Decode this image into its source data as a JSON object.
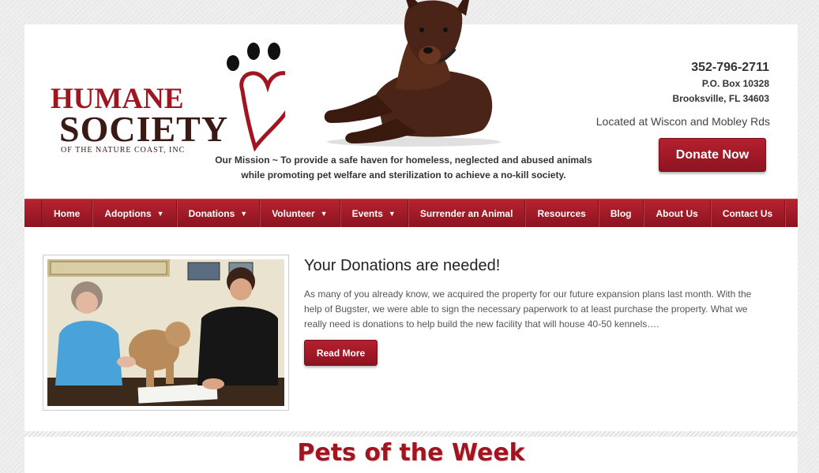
{
  "logo": {
    "word1": "HUMANE",
    "word2": "SOCIETY",
    "subtitle": "OF THE NATURE COAST, INC"
  },
  "contact": {
    "phone": "352-796-2711",
    "po_box": "P.O. Box 10328",
    "city": "Brooksville, FL 34603",
    "location": "Located at Wiscon and Mobley Rds"
  },
  "mission": {
    "line1": "Our Mission ~ To provide a safe haven for homeless, neglected and abused animals",
    "line2": "while promoting pet welfare and sterilization to achieve a no-kill society."
  },
  "donate_label": "Donate Now",
  "nav": {
    "items": [
      {
        "label": "Home"
      },
      {
        "label": "Adoptions"
      },
      {
        "label": "Donations"
      },
      {
        "label": "Volunteer"
      },
      {
        "label": "Events"
      },
      {
        "label": "Surrender an Animal"
      },
      {
        "label": "Resources"
      },
      {
        "label": "Blog"
      },
      {
        "label": "About Us"
      },
      {
        "label": "Contact Us"
      }
    ]
  },
  "article": {
    "title": "Your Donations are needed!",
    "body": "As many of you already know, we acquired the property for our future expansion plans last month. With the help of Bugster, we were able to sign the necessary paperwork to at least purchase the property. What we really need is donations to help build the new facility that will house 40-50 kennels….",
    "read_more": "Read More"
  },
  "pets_heading": "Pets of the Week",
  "colors": {
    "brand_red": "#a0151f",
    "nav_top": "#b7232f",
    "nav_bottom": "#8c1320"
  }
}
